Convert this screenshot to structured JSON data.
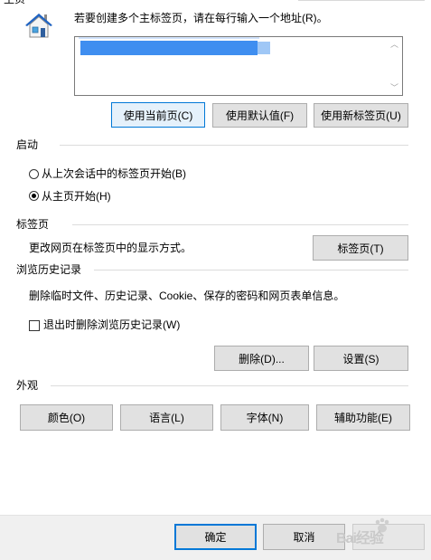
{
  "top": {
    "cut_label": "主页"
  },
  "home": {
    "description": "若要创建多个主标签页，请在每行输入一个地址(R)。",
    "buttons": [
      "使用当前页(C)",
      "使用默认值(F)",
      "使用新标签页(U)"
    ]
  },
  "startup": {
    "title": "启动",
    "options": [
      "从上次会话中的标签页开始(B)",
      "从主页开始(H)"
    ],
    "selected": 1
  },
  "tabs": {
    "title": "标签页",
    "description": "更改网页在标签页中的显示方式。",
    "button": "标签页(T)"
  },
  "history": {
    "title": "浏览历史记录",
    "description": "删除临时文件、历史记录、Cookie、保存的密码和网页表单信息。",
    "checkbox_label": "退出时删除浏览历史记录(W)",
    "checkbox_checked": false,
    "delete_button": "删除(D)...",
    "settings_button": "设置(S)"
  },
  "appearance": {
    "title": "外观",
    "buttons": [
      "颜色(O)",
      "语言(L)",
      "字体(N)",
      "辅助功能(E)"
    ]
  },
  "footer": {
    "ok": "确定",
    "cancel": "取消",
    "watermark": "Bai经验"
  },
  "colors": {
    "accent": "#0078d7",
    "button_face": "#e1e1e1",
    "selection": "#3f8ef0"
  }
}
